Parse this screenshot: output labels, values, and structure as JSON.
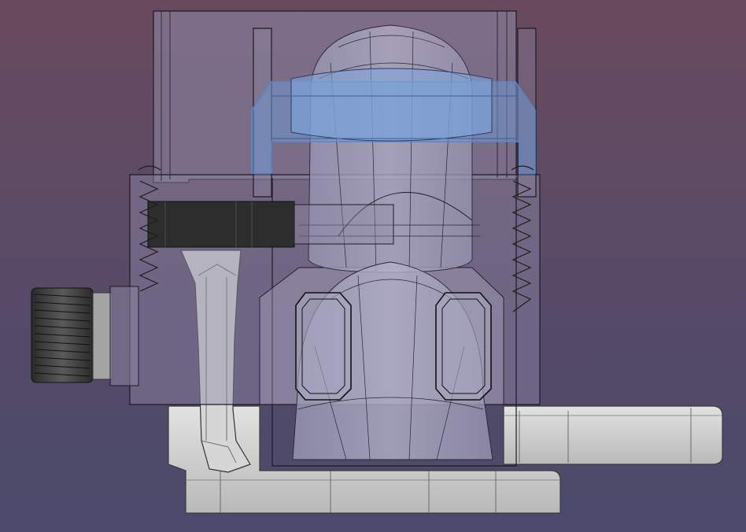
{
  "view": {
    "type": "cad-3d-viewport",
    "background_top": "#694a5e",
    "background_bottom": "#4b4a6b"
  },
  "colors": {
    "housing_fill": "#8f8aa6",
    "housing_line": "#1e1a26",
    "highlight_fill": "#6f98cf",
    "highlight_line": "#5b86c4",
    "rod_dark": "#2d2d2d",
    "plate_light": "#cfcfcf",
    "plate_shadow": "#a8a8a8",
    "thread_dark": "#3a3a3a"
  },
  "parts": [
    {
      "name": "transparent-housing"
    },
    {
      "name": "selected-clamp-bracket"
    },
    {
      "name": "top-dome"
    },
    {
      "name": "bottom-dome"
    },
    {
      "name": "dark-shaft"
    },
    {
      "name": "threaded-fitting"
    },
    {
      "name": "left-spring"
    },
    {
      "name": "right-spring"
    },
    {
      "name": "base-plate"
    },
    {
      "name": "right-arm"
    },
    {
      "name": "lever"
    }
  ]
}
